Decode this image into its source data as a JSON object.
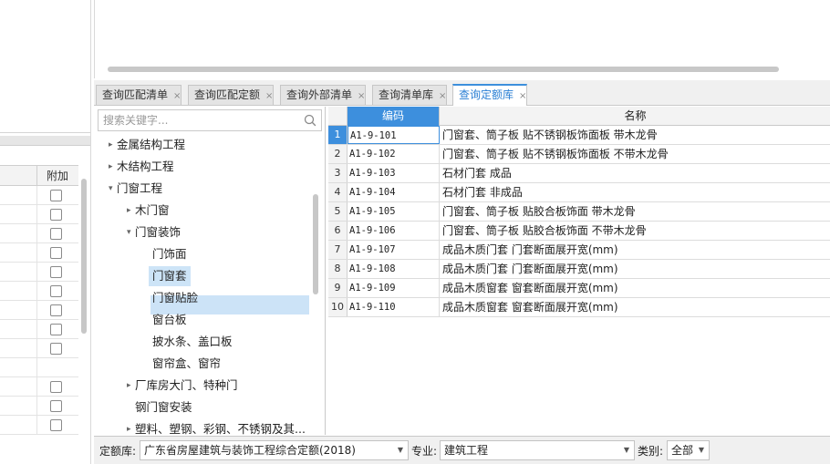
{
  "left_panel": {
    "column_header": "附加",
    "rows": [
      {
        "checkbox": true
      },
      {
        "checkbox": true
      },
      {
        "checkbox": true
      },
      {
        "checkbox": true
      },
      {
        "checkbox": true
      },
      {
        "checkbox": true
      },
      {
        "checkbox": true
      },
      {
        "checkbox": true
      },
      {
        "checkbox": true
      },
      {
        "checkbox": false
      },
      {
        "checkbox": true
      },
      {
        "checkbox": true
      },
      {
        "checkbox": true
      }
    ]
  },
  "tabs": [
    {
      "label": "查询匹配清单",
      "close": "×",
      "active": false
    },
    {
      "label": "查询匹配定额",
      "close": "×",
      "active": false
    },
    {
      "label": "查询外部清单",
      "close": "×",
      "active": false
    },
    {
      "label": "查询清单库",
      "close": "×",
      "active": false
    },
    {
      "label": "查询定额库",
      "close": "×",
      "active": true
    }
  ],
  "search": {
    "placeholder": "搜索关键字...",
    "icon": "search-icon"
  },
  "tree": [
    {
      "label": "金属结构工程",
      "level": 0,
      "arrow": "▸"
    },
    {
      "label": "木结构工程",
      "level": 0,
      "arrow": "▸"
    },
    {
      "label": "门窗工程",
      "level": 0,
      "arrow": "▾"
    },
    {
      "label": "木门窗",
      "level": 1,
      "arrow": "▸"
    },
    {
      "label": "门窗装饰",
      "level": 1,
      "arrow": "▾"
    },
    {
      "label": "门饰面",
      "level": 2,
      "arrow": ""
    },
    {
      "label": "门窗套",
      "level": 2,
      "arrow": "",
      "selected": true
    },
    {
      "label": "门窗贴脸",
      "level": 2,
      "arrow": ""
    },
    {
      "label": "窗台板",
      "level": 2,
      "arrow": ""
    },
    {
      "label": "披水条、盖口板",
      "level": 2,
      "arrow": ""
    },
    {
      "label": "窗帘盒、窗帘",
      "level": 2,
      "arrow": ""
    },
    {
      "label": "厂库房大门、特种门",
      "level": 1,
      "arrow": "▸"
    },
    {
      "label": "钢门窗安装",
      "level": 1,
      "arrow": ""
    },
    {
      "label": "塑料、塑钢、彩钢、不锈钢及其...",
      "level": 1,
      "arrow": "▸"
    }
  ],
  "grid": {
    "headers": {
      "code": "编码",
      "name": "名称"
    },
    "rows": [
      {
        "no": "1",
        "code": "A1-9-101",
        "name": "门窗套、筒子板 贴不锈钢板饰面板 带木龙骨"
      },
      {
        "no": "2",
        "code": "A1-9-102",
        "name": "门窗套、筒子板 贴不锈钢板饰面板 不带木龙骨"
      },
      {
        "no": "3",
        "code": "A1-9-103",
        "name": "石材门套 成品"
      },
      {
        "no": "4",
        "code": "A1-9-104",
        "name": "石材门套 非成品"
      },
      {
        "no": "5",
        "code": "A1-9-105",
        "name": "门窗套、筒子板 贴胶合板饰面 带木龙骨"
      },
      {
        "no": "6",
        "code": "A1-9-106",
        "name": "门窗套、筒子板 贴胶合板饰面 不带木龙骨"
      },
      {
        "no": "7",
        "code": "A1-9-107",
        "name": "成品木质门套 门套断面展开宽(mm)"
      },
      {
        "no": "8",
        "code": "A1-9-108",
        "name": "成品木质门套 门套断面展开宽(mm)"
      },
      {
        "no": "9",
        "code": "A1-9-109",
        "name": "成品木质窗套 窗套断面展开宽(mm)"
      },
      {
        "no": "10",
        "code": "A1-9-110",
        "name": "成品木质窗套 窗套断面展开宽(mm)"
      }
    ]
  },
  "bottom_bar": {
    "quota_label": "定额库:",
    "quota_value": "广东省房屋建筑与装饰工程综合定额(2018)",
    "major_label": "专业:",
    "major_value": "建筑工程",
    "category_label": "类别:",
    "category_value": "全部"
  },
  "colors": {
    "accent": "#3d8fdd",
    "selection": "#cce3f7",
    "active_tab_text": "#2a7fd4"
  }
}
